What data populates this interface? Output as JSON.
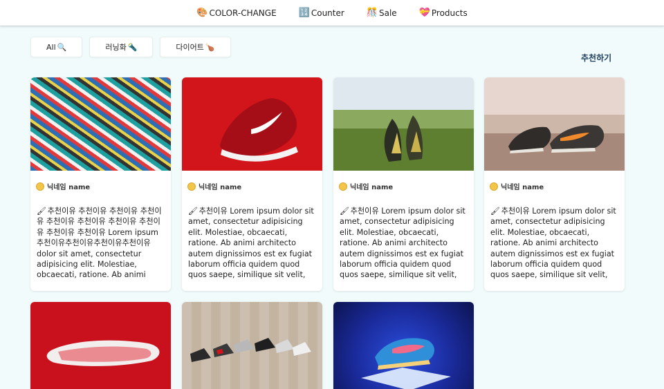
{
  "nav": {
    "items": [
      {
        "icon": "🎨",
        "label": "COLOR-CHANGE"
      },
      {
        "icon": "🔢",
        "label": "Counter"
      },
      {
        "icon": "🎊",
        "label": "Sale"
      },
      {
        "icon": "💝",
        "label": "Products"
      }
    ]
  },
  "filters": [
    {
      "label": "All",
      "icon": "🔍"
    },
    {
      "label": "러닝화",
      "icon": "🔦"
    },
    {
      "label": "다이어트",
      "icon": "🍗"
    }
  ],
  "recommend_label": "추천하기",
  "cards": [
    {
      "image": "pile-of-sneakers",
      "author": "닉네임 name",
      "text": "추천이유 추천이유 추천이유 추천이유 추천이유 추천이유 추천이유 추천이유 추천이유 추천이유 Lorem ipsum 추천이유추천이유추천이유추천이유 dolor sit amet, consectetur adipisicing elit. Molestiae, obcaecati, ratione. Ab animi"
    },
    {
      "image": "red-sneaker",
      "author": "닉네임 name",
      "text": "추천이유 Lorem ipsum dolor sit amet, consectetur adipisicing elit. Molestiae, obcaecati, ratione. Ab animi architecto autem dignissimos est ex fugiat laborum officia quidem quod quos saepe, similique sit velit, voluptate."
    },
    {
      "image": "sneakers-in-field",
      "author": "닉네임 name",
      "text": "추천이유 Lorem ipsum dolor sit amet, consectetur adipisicing elit. Molestiae, obcaecati, ratione. Ab animi architecto autem dignissimos est ex fugiat laborum officia quidem quod quos saepe, similique sit velit, voluptate."
    },
    {
      "image": "sneakers-on-beach",
      "author": "닉네임 name",
      "text": "추천이유 Lorem ipsum dolor sit amet, consectetur adipisicing elit. Molestiae, obcaecati, ratione. Ab animi architecto autem dignissimos est ex fugiat laborum officia quidem quod quos saepe, similique sit velit, voluptate."
    },
    {
      "image": "red-sneaker-sole",
      "author": "",
      "text": ""
    },
    {
      "image": "sneakers-row-wood",
      "author": "",
      "text": ""
    },
    {
      "image": "blue-sneaker-pedestal",
      "author": "",
      "text": ""
    }
  ],
  "colors": {
    "page_bg": "#f1fbfb",
    "accent_text": "#1e3e5e"
  }
}
